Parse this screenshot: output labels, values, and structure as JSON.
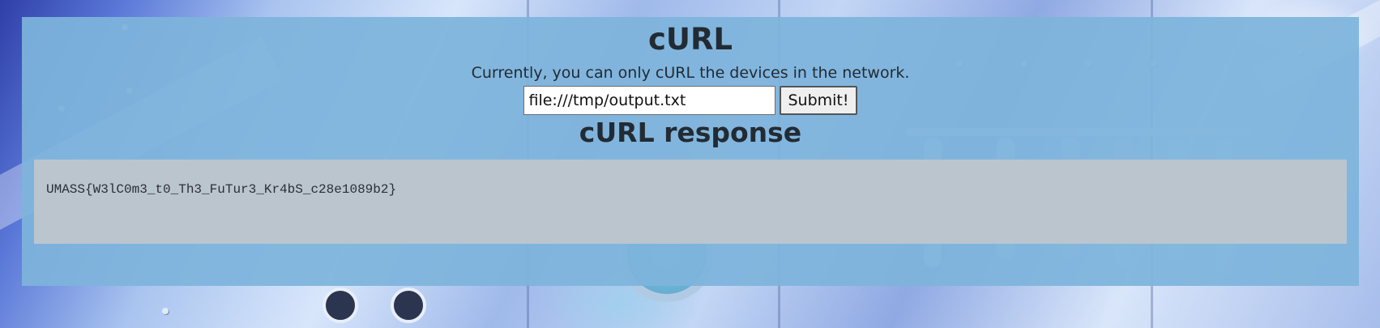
{
  "page": {
    "title": "cURL",
    "subtitle": "Currently, you can only cURL the devices in the network."
  },
  "form": {
    "url_value": "file:///tmp/output.txt",
    "submit_label": "Submit!"
  },
  "response": {
    "heading": "cURL response",
    "body": "UMASS{W3lC0m3_t0_Th3_FuTur3_Kr4bS_c28e1089b2}"
  },
  "colors": {
    "panel": "#7eb4db",
    "response_box": "#c0c6cc",
    "text": "#222b33"
  }
}
